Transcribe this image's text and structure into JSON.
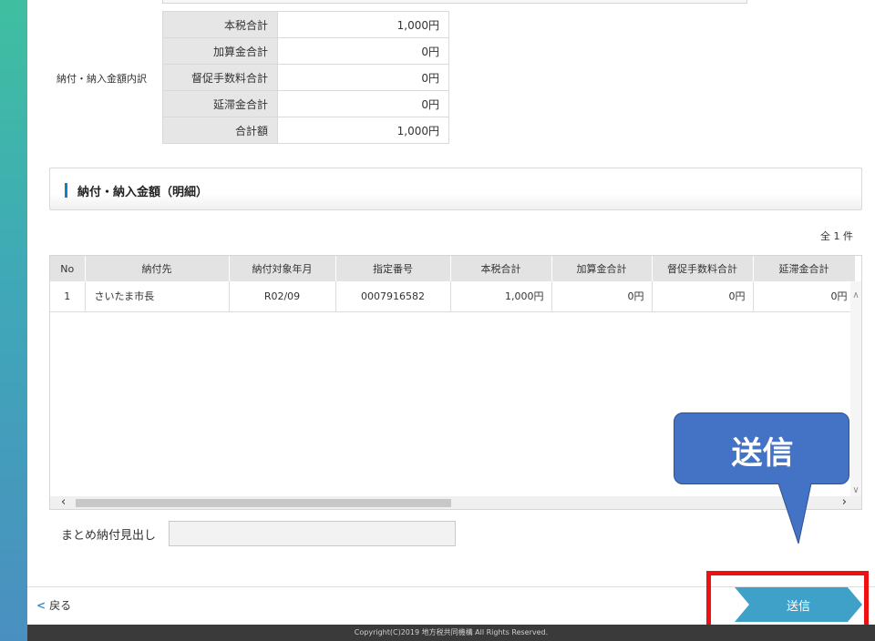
{
  "breakdown": {
    "label": "納付・納入金額内訳",
    "rows": [
      {
        "key": "本税合計",
        "value": "1,000円"
      },
      {
        "key": "加算金合計",
        "value": "0円"
      },
      {
        "key": "督促手数料合計",
        "value": "0円"
      },
      {
        "key": "延滞金合計",
        "value": "0円"
      },
      {
        "key": "合計額",
        "value": "1,000円"
      }
    ]
  },
  "details": {
    "title": "納付・納入金額（明細）",
    "count": "全 1 件",
    "columns": [
      "No",
      "納付先",
      "納付対象年月",
      "指定番号",
      "本税合計",
      "加算金合計",
      "督促手数料合計",
      "延滞金合計"
    ],
    "rows": [
      {
        "no": "1",
        "payee": "さいたま市長",
        "period": "R02/09",
        "number": "0007916582",
        "tax": "1,000円",
        "addition": "0円",
        "fee": "0円",
        "delay": "0円"
      }
    ]
  },
  "summary": {
    "label": "まとめ納付見出し",
    "value": ""
  },
  "footer": {
    "back_label": "戻る",
    "send_label": "送信",
    "copyright": "Copyright(C)2019 地方税共同機構 All Rights Reserved."
  },
  "callout": {
    "text": "送信"
  },
  "colors": {
    "accent": "#1a7fc0",
    "send_button": "#3fa0c8",
    "callout": "#4472c4",
    "highlight_frame": "#ee1111"
  }
}
